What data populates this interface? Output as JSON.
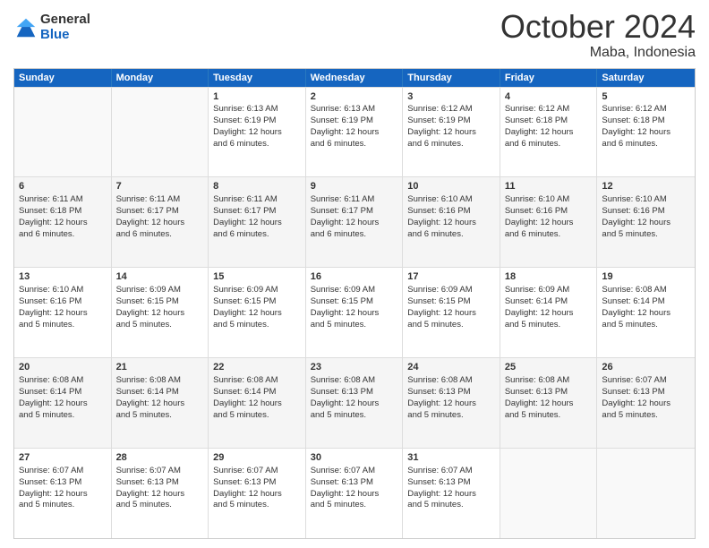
{
  "logo": {
    "general": "General",
    "blue": "Blue"
  },
  "title": "October 2024",
  "location": "Maba, Indonesia",
  "header_days": [
    "Sunday",
    "Monday",
    "Tuesday",
    "Wednesday",
    "Thursday",
    "Friday",
    "Saturday"
  ],
  "weeks": [
    [
      {
        "day": "",
        "info": ""
      },
      {
        "day": "",
        "info": ""
      },
      {
        "day": "1",
        "info": "Sunrise: 6:13 AM\nSunset: 6:19 PM\nDaylight: 12 hours\nand 6 minutes."
      },
      {
        "day": "2",
        "info": "Sunrise: 6:13 AM\nSunset: 6:19 PM\nDaylight: 12 hours\nand 6 minutes."
      },
      {
        "day": "3",
        "info": "Sunrise: 6:12 AM\nSunset: 6:19 PM\nDaylight: 12 hours\nand 6 minutes."
      },
      {
        "day": "4",
        "info": "Sunrise: 6:12 AM\nSunset: 6:18 PM\nDaylight: 12 hours\nand 6 minutes."
      },
      {
        "day": "5",
        "info": "Sunrise: 6:12 AM\nSunset: 6:18 PM\nDaylight: 12 hours\nand 6 minutes."
      }
    ],
    [
      {
        "day": "6",
        "info": "Sunrise: 6:11 AM\nSunset: 6:18 PM\nDaylight: 12 hours\nand 6 minutes."
      },
      {
        "day": "7",
        "info": "Sunrise: 6:11 AM\nSunset: 6:17 PM\nDaylight: 12 hours\nand 6 minutes."
      },
      {
        "day": "8",
        "info": "Sunrise: 6:11 AM\nSunset: 6:17 PM\nDaylight: 12 hours\nand 6 minutes."
      },
      {
        "day": "9",
        "info": "Sunrise: 6:11 AM\nSunset: 6:17 PM\nDaylight: 12 hours\nand 6 minutes."
      },
      {
        "day": "10",
        "info": "Sunrise: 6:10 AM\nSunset: 6:16 PM\nDaylight: 12 hours\nand 6 minutes."
      },
      {
        "day": "11",
        "info": "Sunrise: 6:10 AM\nSunset: 6:16 PM\nDaylight: 12 hours\nand 6 minutes."
      },
      {
        "day": "12",
        "info": "Sunrise: 6:10 AM\nSunset: 6:16 PM\nDaylight: 12 hours\nand 5 minutes."
      }
    ],
    [
      {
        "day": "13",
        "info": "Sunrise: 6:10 AM\nSunset: 6:16 PM\nDaylight: 12 hours\nand 5 minutes."
      },
      {
        "day": "14",
        "info": "Sunrise: 6:09 AM\nSunset: 6:15 PM\nDaylight: 12 hours\nand 5 minutes."
      },
      {
        "day": "15",
        "info": "Sunrise: 6:09 AM\nSunset: 6:15 PM\nDaylight: 12 hours\nand 5 minutes."
      },
      {
        "day": "16",
        "info": "Sunrise: 6:09 AM\nSunset: 6:15 PM\nDaylight: 12 hours\nand 5 minutes."
      },
      {
        "day": "17",
        "info": "Sunrise: 6:09 AM\nSunset: 6:15 PM\nDaylight: 12 hours\nand 5 minutes."
      },
      {
        "day": "18",
        "info": "Sunrise: 6:09 AM\nSunset: 6:14 PM\nDaylight: 12 hours\nand 5 minutes."
      },
      {
        "day": "19",
        "info": "Sunrise: 6:08 AM\nSunset: 6:14 PM\nDaylight: 12 hours\nand 5 minutes."
      }
    ],
    [
      {
        "day": "20",
        "info": "Sunrise: 6:08 AM\nSunset: 6:14 PM\nDaylight: 12 hours\nand 5 minutes."
      },
      {
        "day": "21",
        "info": "Sunrise: 6:08 AM\nSunset: 6:14 PM\nDaylight: 12 hours\nand 5 minutes."
      },
      {
        "day": "22",
        "info": "Sunrise: 6:08 AM\nSunset: 6:14 PM\nDaylight: 12 hours\nand 5 minutes."
      },
      {
        "day": "23",
        "info": "Sunrise: 6:08 AM\nSunset: 6:13 PM\nDaylight: 12 hours\nand 5 minutes."
      },
      {
        "day": "24",
        "info": "Sunrise: 6:08 AM\nSunset: 6:13 PM\nDaylight: 12 hours\nand 5 minutes."
      },
      {
        "day": "25",
        "info": "Sunrise: 6:08 AM\nSunset: 6:13 PM\nDaylight: 12 hours\nand 5 minutes."
      },
      {
        "day": "26",
        "info": "Sunrise: 6:07 AM\nSunset: 6:13 PM\nDaylight: 12 hours\nand 5 minutes."
      }
    ],
    [
      {
        "day": "27",
        "info": "Sunrise: 6:07 AM\nSunset: 6:13 PM\nDaylight: 12 hours\nand 5 minutes."
      },
      {
        "day": "28",
        "info": "Sunrise: 6:07 AM\nSunset: 6:13 PM\nDaylight: 12 hours\nand 5 minutes."
      },
      {
        "day": "29",
        "info": "Sunrise: 6:07 AM\nSunset: 6:13 PM\nDaylight: 12 hours\nand 5 minutes."
      },
      {
        "day": "30",
        "info": "Sunrise: 6:07 AM\nSunset: 6:13 PM\nDaylight: 12 hours\nand 5 minutes."
      },
      {
        "day": "31",
        "info": "Sunrise: 6:07 AM\nSunset: 6:13 PM\nDaylight: 12 hours\nand 5 minutes."
      },
      {
        "day": "",
        "info": ""
      },
      {
        "day": "",
        "info": ""
      }
    ]
  ]
}
